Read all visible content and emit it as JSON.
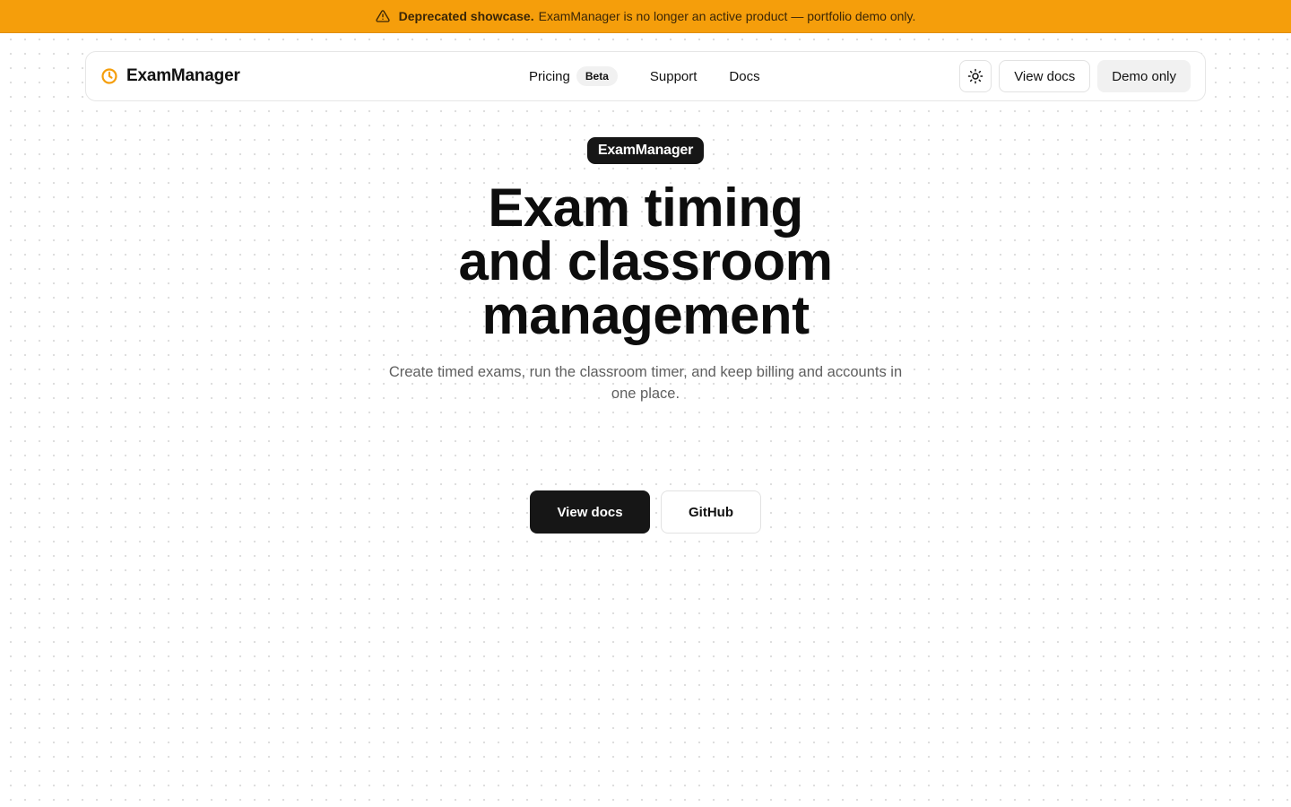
{
  "banner": {
    "icon": "warning-triangle-icon",
    "strong": "Deprecated showcase.",
    "text": "ExamManager is no longer an active product — portfolio demo only.",
    "background_color": "#f59e0b"
  },
  "navbar": {
    "brand": {
      "icon": "clock-icon",
      "icon_color": "#f59e0b",
      "name": "ExamManager"
    },
    "links": [
      {
        "label": "Pricing",
        "badge": "Beta"
      },
      {
        "label": "Support"
      },
      {
        "label": "Docs"
      }
    ],
    "theme_toggle_icon": "sun-icon",
    "view_docs_label": "View docs",
    "demo_only_label": "Demo only"
  },
  "hero": {
    "badge": "ExamManager",
    "title_lines": [
      "Exam timing",
      "and classroom",
      "management"
    ],
    "subtitle": "Create timed exams, run the classroom timer, and keep billing and accounts in one place.",
    "primary_cta": "View docs",
    "secondary_cta": "GitHub"
  }
}
